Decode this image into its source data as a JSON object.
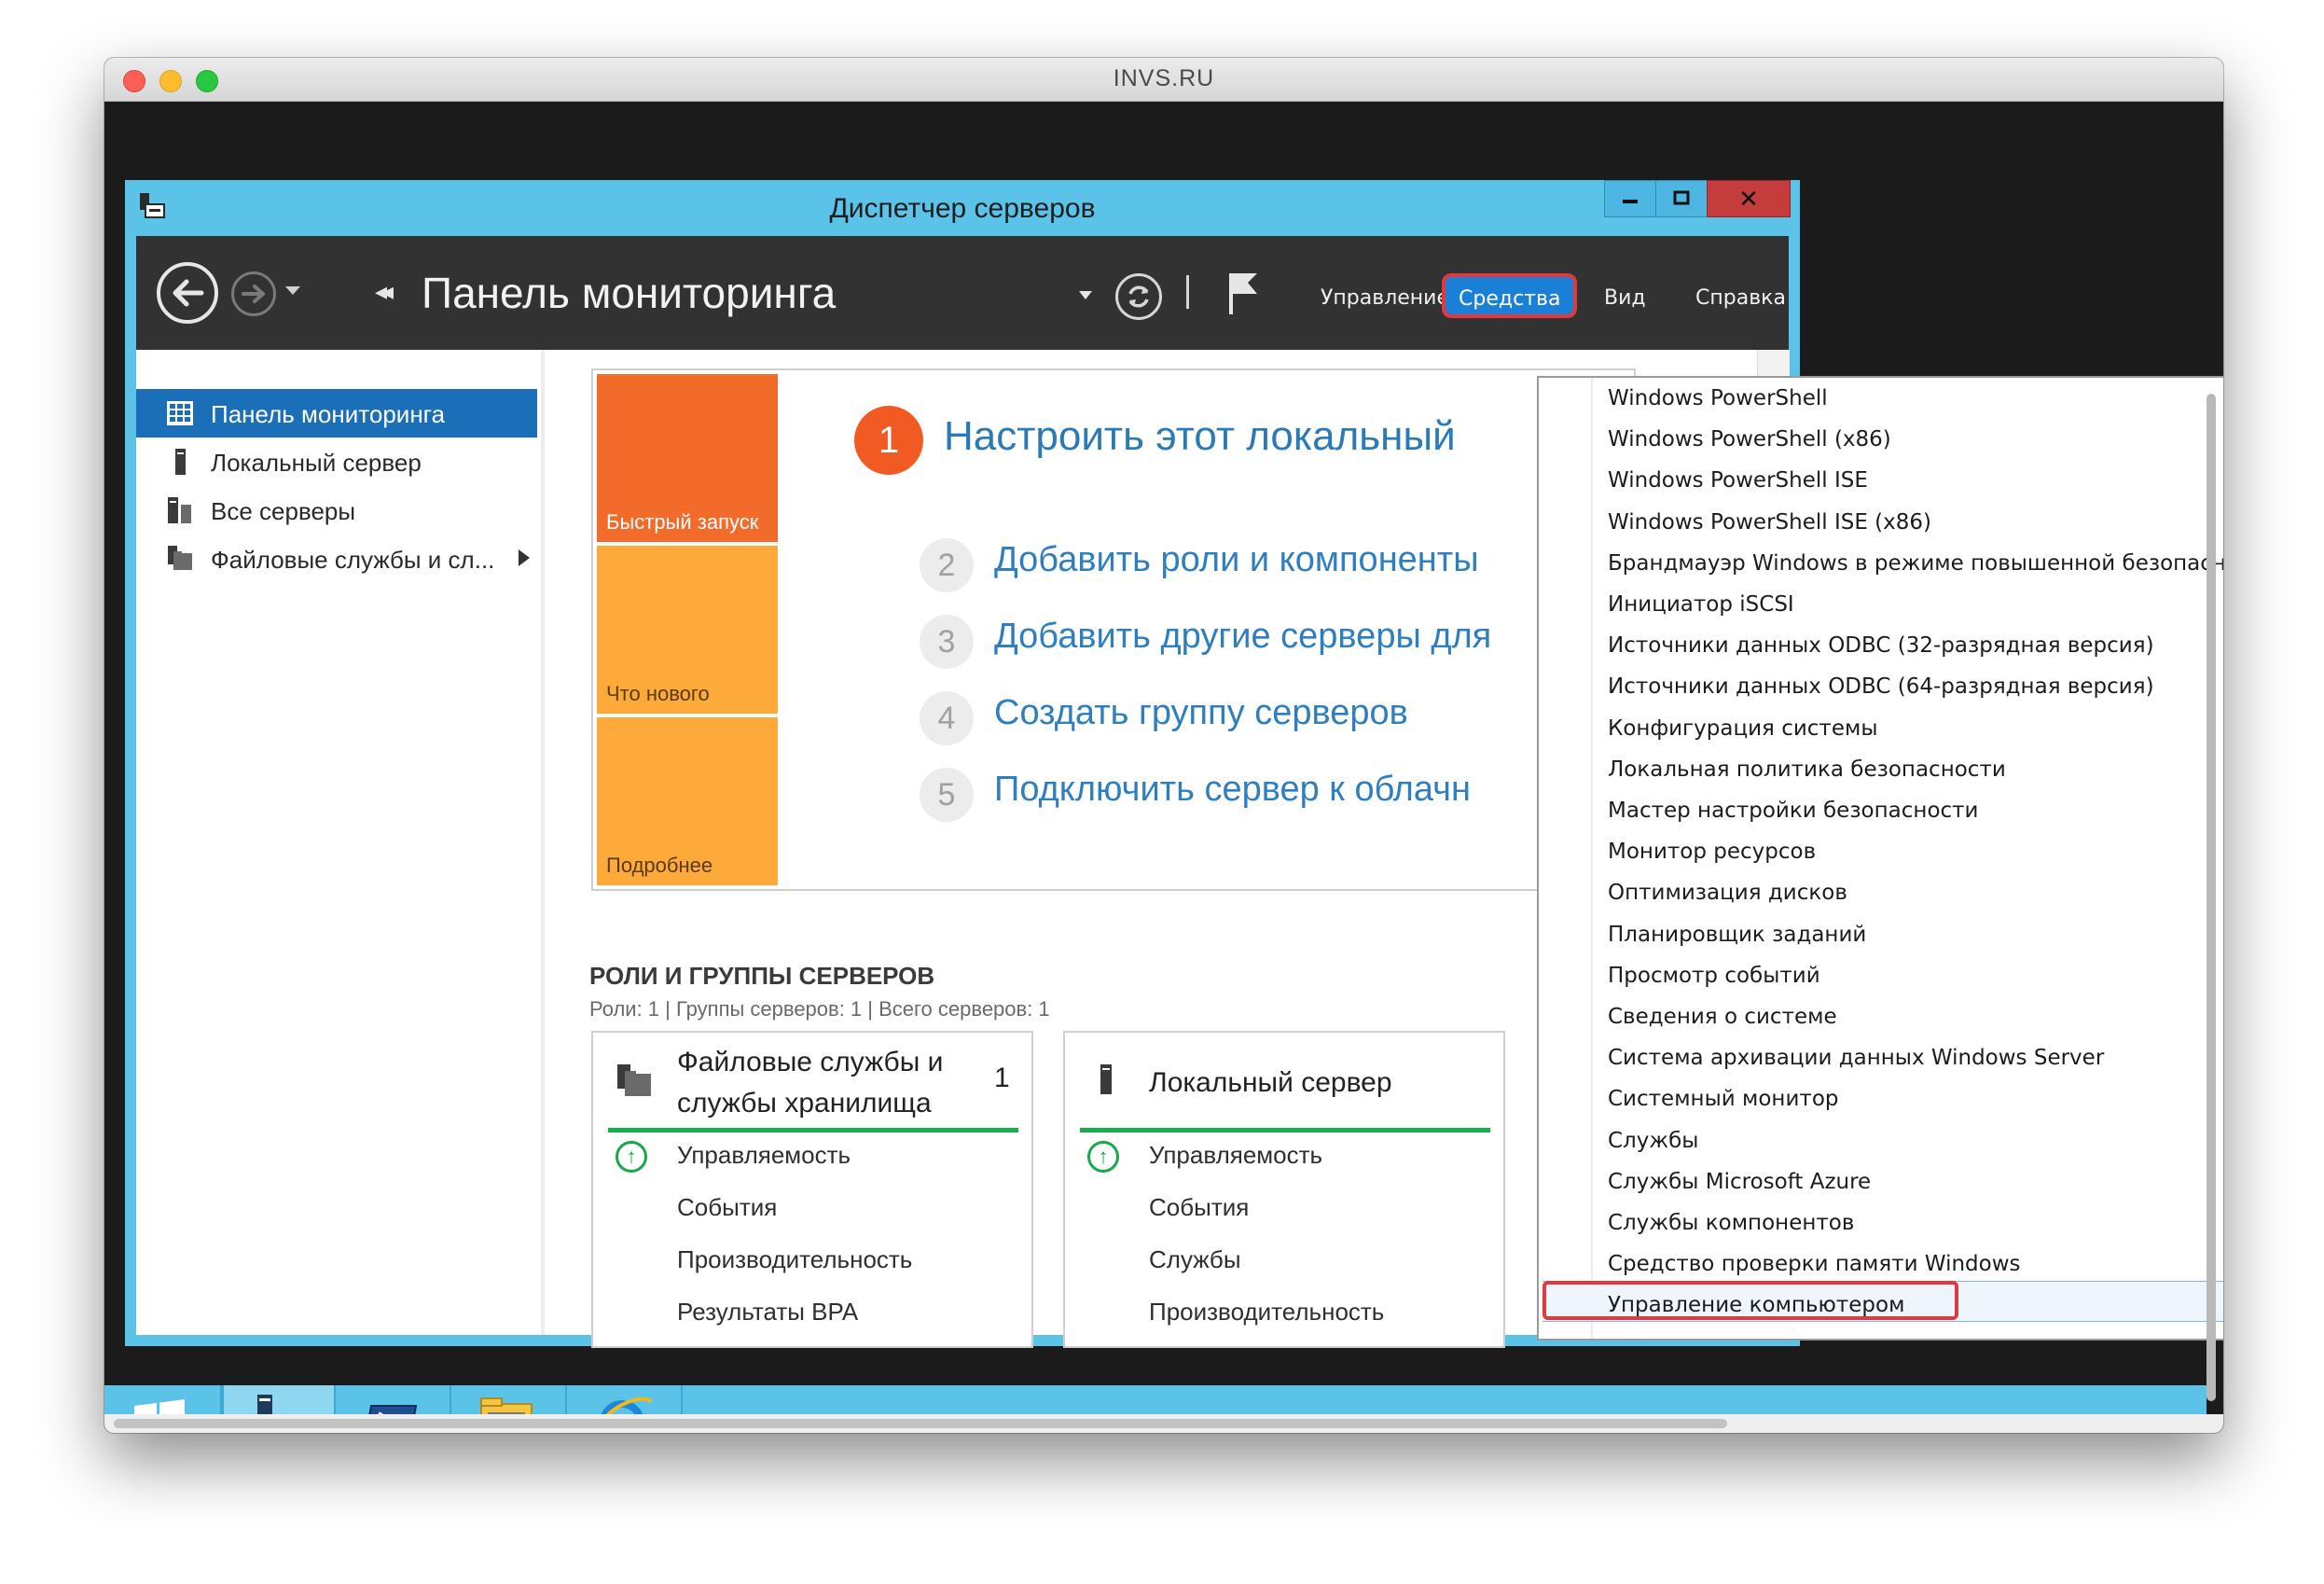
{
  "mac": {
    "title": "INVS.RU"
  },
  "window": {
    "title": "Диспетчер серверов",
    "minimize": "",
    "maximize": "",
    "close": "✕"
  },
  "toolbar": {
    "breadcrumb": "Панель мониторинга",
    "menus": {
      "manage": "Управление",
      "tools": "Средства",
      "view": "Вид",
      "help": "Справка"
    }
  },
  "nav": {
    "items": [
      {
        "label": "Панель мониторинга",
        "selected": true
      },
      {
        "label": "Локальный сервер"
      },
      {
        "label": "Все серверы"
      },
      {
        "label": "Файловые службы и сл..."
      }
    ]
  },
  "welcome": {
    "tiles": [
      "Быстрый запуск",
      "Что нового",
      "Подробнее"
    ],
    "step1": {
      "number": "1",
      "text": "Настроить этот локальный"
    },
    "steps": [
      {
        "number": "2",
        "text": "Добавить роли и компоненты"
      },
      {
        "number": "3",
        "text": "Добавить другие серверы для"
      },
      {
        "number": "4",
        "text": "Создать группу серверов"
      },
      {
        "number": "5",
        "text": "Подключить сервер к облачн"
      }
    ]
  },
  "roles": {
    "heading": "РОЛИ И ГРУППЫ СЕРВЕРОВ",
    "summary": "Роли: 1 | Группы серверов: 1 | Всего серверов: 1",
    "cards": [
      {
        "title": "Файловые службы и службы хранилища",
        "count": "1",
        "rows": [
          "Управляемость",
          "События",
          "Производительность",
          "Результаты BPA"
        ]
      },
      {
        "title": "Локальный сервер",
        "count": "",
        "rows": [
          "Управляемость",
          "События",
          "Службы",
          "Производительность"
        ]
      }
    ]
  },
  "tools_menu": {
    "items": [
      "Windows PowerShell",
      "Windows PowerShell (x86)",
      "Windows PowerShell ISE",
      "Windows PowerShell ISE (x86)",
      "Брандмауэр Windows в режиме повышенной безопасности",
      "Инициатор iSCSI",
      "Источники данных ODBC (32-разрядная версия)",
      "Источники данных ODBC (64-разрядная версия)",
      "Конфигурация системы",
      "Локальная политика безопасности",
      "Мастер настройки безопасности",
      "Монитор ресурсов",
      "Оптимизация дисков",
      "Планировщик заданий",
      "Просмотр событий",
      "Сведения о системе",
      "Система архивации данных Windows Server",
      "Системный монитор",
      "Службы",
      "Службы Microsoft Azure",
      "Службы компонентов",
      "Средство проверки памяти Windows",
      "Управление компьютером"
    ],
    "highlighted": "Управление компьютером"
  },
  "colors": {
    "accent": "#5bc3e8",
    "highlight_red": "#e3393e",
    "tile_orange": "#f26b2a",
    "tile_yellow": "#fdaa3b",
    "link_blue": "#2f7fc0",
    "status_green": "#18a84a"
  },
  "icons": {
    "start": "windows-logo-icon",
    "server_manager": "server-manager-icon",
    "powershell": "powershell-icon",
    "explorer": "file-explorer-icon",
    "ie": "internet-explorer-icon"
  }
}
